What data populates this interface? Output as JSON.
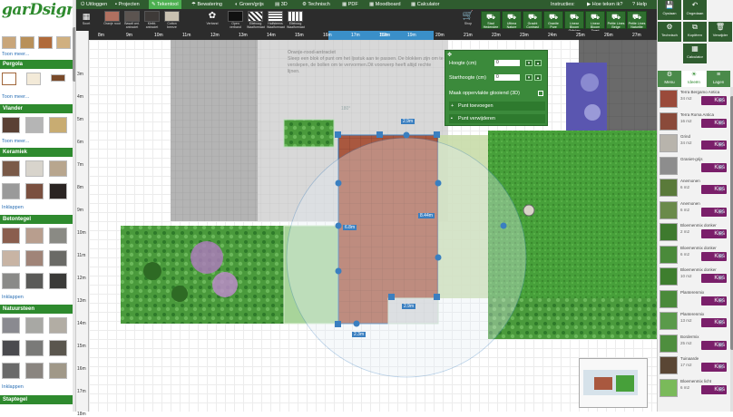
{
  "app": {
    "logo": "garDsign"
  },
  "left_sidebar": {
    "sections": [
      {
        "title": "Pergola",
        "link": "Toon meer..."
      },
      {
        "title": "Vlander",
        "link": "Toon meer..."
      },
      {
        "title": "Keramiek",
        "link": "Inklappen"
      },
      {
        "title": "Betontegel",
        "link": "Inklappen"
      },
      {
        "title": "Natuursteen",
        "link": "Inklappen"
      },
      {
        "title": "Staptegel",
        "link": ""
      }
    ],
    "top_link": "Toon meer..."
  },
  "top_menu": {
    "items": [
      "Uitloggen",
      "Projecten",
      "Tekentool",
      "Bewatering",
      "Groen/grijs",
      "3D",
      "Technisch",
      "PDF",
      "Moodboard",
      "Calculator"
    ],
    "active": "Tekentool",
    "instructies_label": "Instructies:",
    "howto_label": "Hoe teken ik?",
    "help_label": "Help"
  },
  "toolbar": {
    "sort_label": "Soort",
    "materials": [
      "Oranje rood",
      "Basalt ant. antraciet",
      "Kleibi. antraciet",
      "Cotton breeze"
    ],
    "verband_label": "Verband",
    "patterns": [
      "Open verband",
      "Elleboog Waalformaat",
      "Halfsteens Waalformaat",
      "Elleboog Waalformaat"
    ],
    "shop_label": "Shop",
    "shop_buttons": [
      "Stad Hedendee",
      "Ultima Nature",
      "Gracht Contrast",
      "Granite Pure",
      "Linear Bloom Grijs/zw",
      "Linear Bloom Zwart",
      "Petite Lines Beige",
      "Petite Lines Naturlite"
    ]
  },
  "ruler": {
    "top_ticks": [
      "8m",
      "9m",
      "10m",
      "11m",
      "12m",
      "13m",
      "14m",
      "15m",
      "16m",
      "17m",
      "18m",
      "19m",
      "20m",
      "21m",
      "22m",
      "23m",
      "24m",
      "25m",
      "26m",
      "27m"
    ],
    "highlight_label": "5.2m",
    "left_ticks": [
      "3m",
      "4m",
      "5m",
      "6m",
      "7m",
      "8m",
      "9m",
      "10m",
      "11m",
      "12m",
      "13m",
      "14m",
      "15m",
      "16m",
      "17m",
      "18m"
    ]
  },
  "hint": {
    "title": "Oranje-rood-antraciet",
    "text": "Sleep een blok of punt om het Ijsstuk aan te passen. De blokken zijn om te verslepen, de bollen om te vervormen.Dit voorwerp heeft altijd rechte lijnen."
  },
  "dimensions": {
    "top": "2.9m",
    "middle_right": "8.44m",
    "left": "6.8m",
    "bottom_inner": "2.9m",
    "bottom": "2.3m",
    "angle": "180°"
  },
  "popup": {
    "hoogte_label": "Hoogte (cm)",
    "hoogte_value": "0",
    "start_label": "Starthoogte (cm)",
    "start_value": "0",
    "slope_label": "Maak oppervlakte glooiend (3D)",
    "add_point": "Punt toevoegen",
    "remove_point": "Punt verwijderen"
  },
  "right_panel": {
    "top_buttons": [
      "Opslaan",
      "Ongedaan",
      "Technisch",
      "Kopiëren",
      "Verwijder",
      "Calculator"
    ],
    "tabs": [
      "Menu",
      "Ideeën",
      "Lagen"
    ],
    "active_tab": "Ideeën",
    "kies_label": "Kies",
    "materials": [
      {
        "name": "Terra Bergamo Antica",
        "size": "34 m2",
        "color": "#9a4a3a"
      },
      {
        "name": "Terra Roma Antica",
        "size": "16 m2",
        "color": "#8a4a3a"
      },
      {
        "name": "Grind",
        "size": "34 m2",
        "color": "#b8b4ac"
      },
      {
        "name": "Graniet-grijs",
        "size": "",
        "color": "#8d8d8d"
      },
      {
        "name": "Anemonen",
        "size": "6 m2",
        "color": "#5a7a3a"
      },
      {
        "name": "Anemonen",
        "size": "6 m2",
        "color": "#6a8a4a"
      },
      {
        "name": "Bloemenmix donker",
        "size": "2 m2",
        "color": "#3e7a2e"
      },
      {
        "name": "Bloemenmix donker",
        "size": "6 m2",
        "color": "#4a8a3a"
      },
      {
        "name": "Bloemenmix donker",
        "size": "10 m2",
        "color": "#3e7e2e"
      },
      {
        "name": "Planterenmix",
        "size": "",
        "color": "#4a8a3a"
      },
      {
        "name": "Planterenmix",
        "size": "13 m2",
        "color": "#5a9a4a"
      },
      {
        "name": "Bordermix",
        "size": "25 m2",
        "color": "#4e8e3e"
      },
      {
        "name": "Tuinaarde",
        "size": "17 m2",
        "color": "#5a4634"
      },
      {
        "name": "Bloemenmix licht",
        "size": "6 m2",
        "color": "#7aba5a"
      }
    ]
  },
  "colors": {
    "brand_green": "#2e8a2e",
    "dark_toolbar": "#2c2c2c",
    "selected_outline": "#3a7fc0",
    "kies_button": "#7a1f6a",
    "brick": "#a05a4a",
    "lawn": "#4aa43a"
  }
}
